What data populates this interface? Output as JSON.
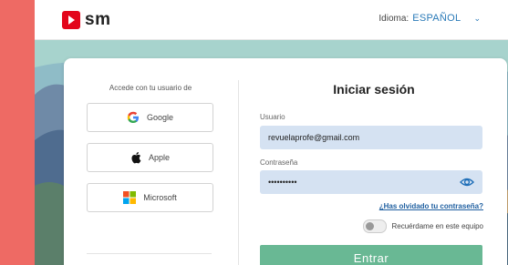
{
  "header": {
    "logo_text": "sm",
    "language_label": "Idioma:",
    "language_value": "ESPAÑOL"
  },
  "sso": {
    "title": "Accede con tu usuario de",
    "google": "Google",
    "apple": "Apple",
    "microsoft": "Microsoft"
  },
  "login": {
    "title": "Iniciar sesión",
    "user_label": "Usuario",
    "user_value": "revuelaprofe@gmail.com",
    "password_label": "Contraseña",
    "password_value": "••••••••••",
    "forgot": "¿Has olvidado tu contraseña?",
    "remember": "Recuérdame en este equipo",
    "submit": "Entrar"
  },
  "colors": {
    "brand": "#e3051b",
    "accent": "#69b894",
    "link": "#1f5fa0",
    "side": "#ee6a64"
  }
}
